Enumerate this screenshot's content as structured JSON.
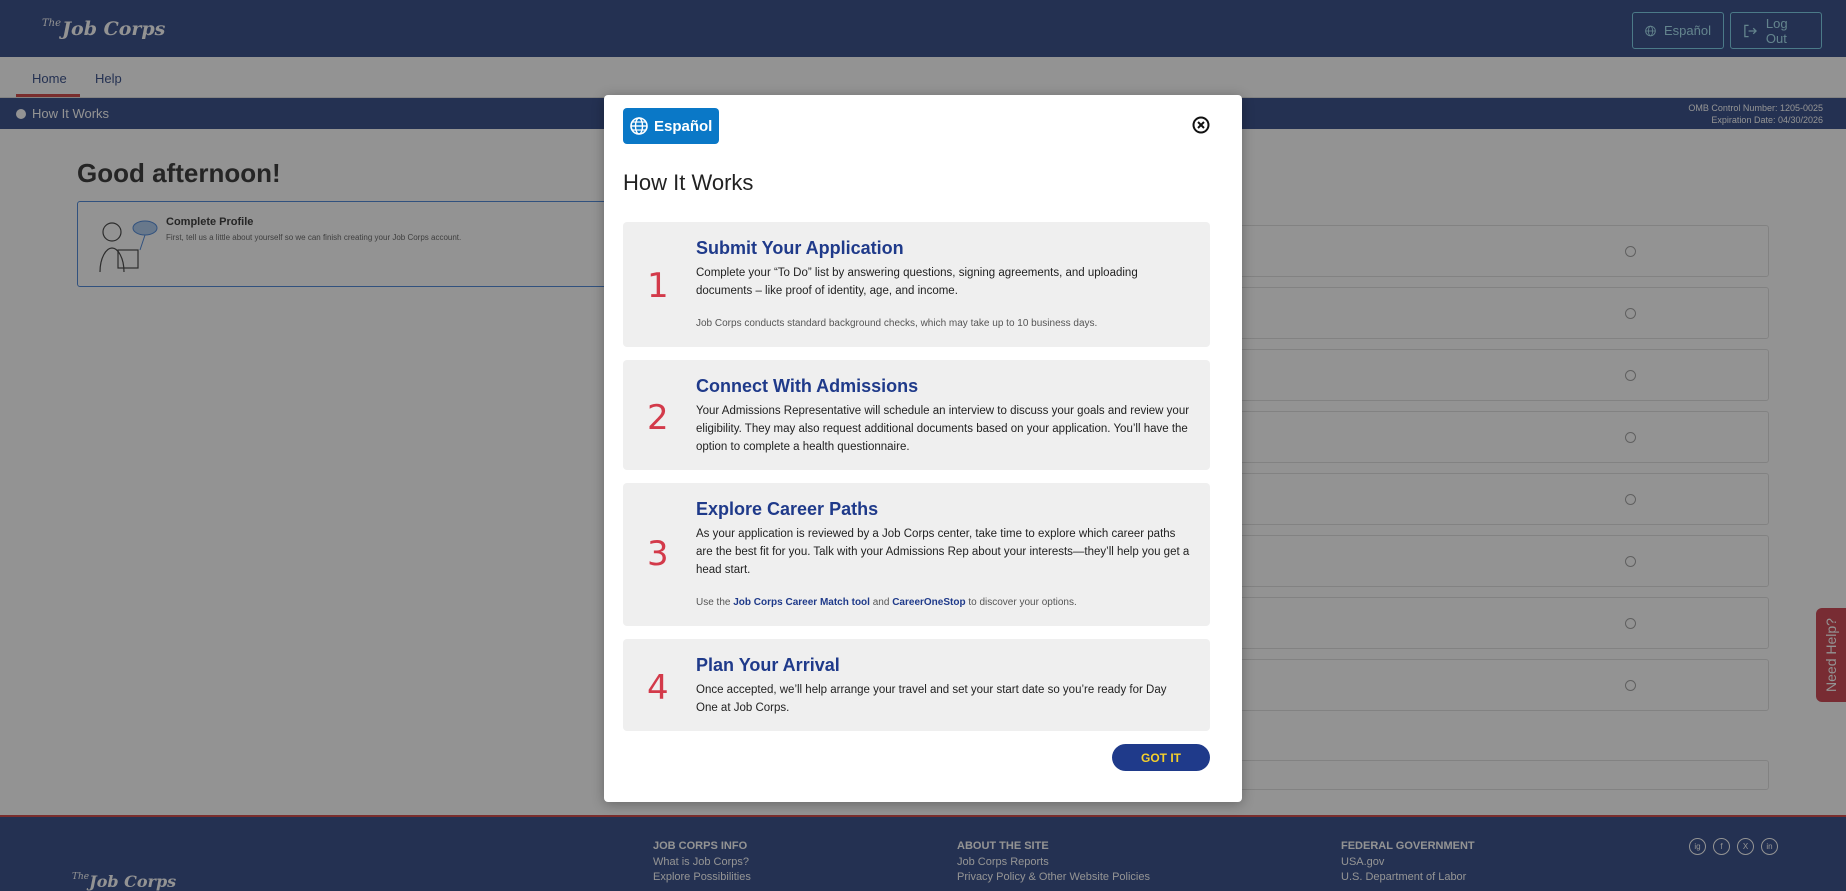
{
  "header": {
    "logo_prefix": "The",
    "logo_text": "Job Corps",
    "espanol_label": "Español",
    "logout_label": "Log Out"
  },
  "nav": {
    "home": "Home",
    "help": "Help"
  },
  "strip": {
    "title": "How It Works",
    "omb_line1": "OMB Control Number: 1205-0025",
    "omb_line2": "Expiration Date: 04/30/2026"
  },
  "main": {
    "greeting": "Good afternoon!",
    "profile_title": "Complete Profile",
    "profile_desc": "First, tell us a little about yourself so we can finish creating your Job Corps account."
  },
  "need_help": "Need Help?",
  "footer": {
    "logo_prefix": "The",
    "logo_text": "Job Corps",
    "col1": {
      "heading": "JOB CORPS INFO",
      "link1": "What is Job Corps?",
      "link2": "Explore Possibilities"
    },
    "col2": {
      "heading": "ABOUT THE SITE",
      "link1": "Job Corps Reports",
      "link2": "Privacy Policy & Other Website Policies"
    },
    "col3": {
      "heading": "FEDERAL GOVERNMENT",
      "link1": "USA.gov",
      "link2": "U.S. Department of Labor"
    },
    "social": [
      "ig",
      "f",
      "X",
      "in"
    ]
  },
  "modal": {
    "espanol_label": "Español",
    "title": "How It Works",
    "steps": [
      {
        "num": "1",
        "title": "Submit Your Application",
        "body": "Complete your “To Do” list by answering questions, signing agreements, and uploading documents – like proof of identity, age, and income.",
        "note": "Job Corps conducts standard background checks, which may take up to 10 business days."
      },
      {
        "num": "2",
        "title": "Connect With Admissions",
        "body": "Your Admissions Representative will schedule an interview to discuss your goals and review your eligibility. They may also request additional documents based on your application. You’ll have the option to complete a health questionnaire."
      },
      {
        "num": "3",
        "title": "Explore Career Paths",
        "body": "As your application is reviewed by a Job Corps center, take time to explore which career paths are the best fit for you. Talk with your Admissions Rep about your interests—they’ll help you get a head start.",
        "note_pre": "Use the ",
        "note_link1": "Job Corps Career Match tool",
        "note_mid": " and ",
        "note_link2": "CareerOneStop",
        "note_post": " to discover your options."
      },
      {
        "num": "4",
        "title": "Plan Your Arrival",
        "body": "Once accepted, we’ll help arrange your travel and set your start date so you’re ready for Day One at Job Corps."
      }
    ],
    "got_it_label": "GOT IT"
  },
  "colors": {
    "navy": "#203a7c",
    "accent_red": "#d33a4a",
    "espanol_blue": "#0a78c7",
    "got_it_text": "#f5d02c"
  }
}
